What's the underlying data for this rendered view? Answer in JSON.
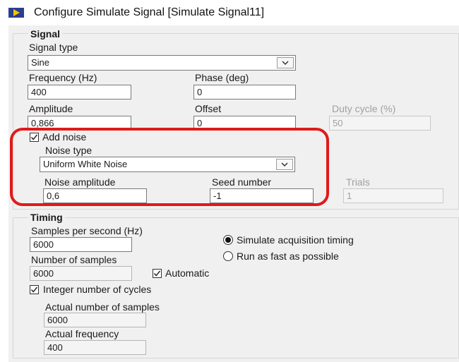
{
  "window": {
    "title": "Configure Simulate Signal [Simulate Signal11]"
  },
  "signal": {
    "section_title": "Signal",
    "signal_type": {
      "label": "Signal type",
      "value": "Sine"
    },
    "frequency": {
      "label": "Frequency (Hz)",
      "value": "400"
    },
    "phase": {
      "label": "Phase (deg)",
      "value": "0"
    },
    "amplitude": {
      "label": "Amplitude",
      "value": "0,866"
    },
    "offset": {
      "label": "Offset",
      "value": "0"
    },
    "duty_cycle": {
      "label": "Duty cycle (%)",
      "value": "50"
    },
    "add_noise": {
      "label": "Add noise",
      "checked": true
    },
    "noise_type": {
      "label": "Noise type",
      "value": "Uniform White Noise"
    },
    "noise_amplitude": {
      "label": "Noise amplitude",
      "value": "0,6"
    },
    "seed_number": {
      "label": "Seed number",
      "value": "-1"
    },
    "trials": {
      "label": "Trials",
      "value": "1"
    }
  },
  "timing": {
    "section_title": "Timing",
    "samples_per_second": {
      "label": "Samples per second (Hz)",
      "value": "6000"
    },
    "timing_mode": {
      "simulate_label": "Simulate acquisition timing",
      "fast_label": "Run as fast as possible",
      "selected": "simulate"
    },
    "number_of_samples": {
      "label": "Number of samples",
      "value": "6000"
    },
    "automatic": {
      "label": "Automatic",
      "checked": true
    },
    "integer_cycles": {
      "label": "Integer number of cycles",
      "checked": true
    },
    "actual_samples": {
      "label": "Actual number of samples",
      "value": "6000"
    },
    "actual_frequency": {
      "label": "Actual frequency",
      "value": "400"
    }
  },
  "colors": {
    "highlight": "#e01a1a",
    "icon_bg": "#2a3f8f",
    "icon_arrow": "#f5c400"
  },
  "icons": {
    "app": "labview-vi-icon",
    "dropdown": "chevron-down-icon",
    "check": "checkmark-icon"
  }
}
